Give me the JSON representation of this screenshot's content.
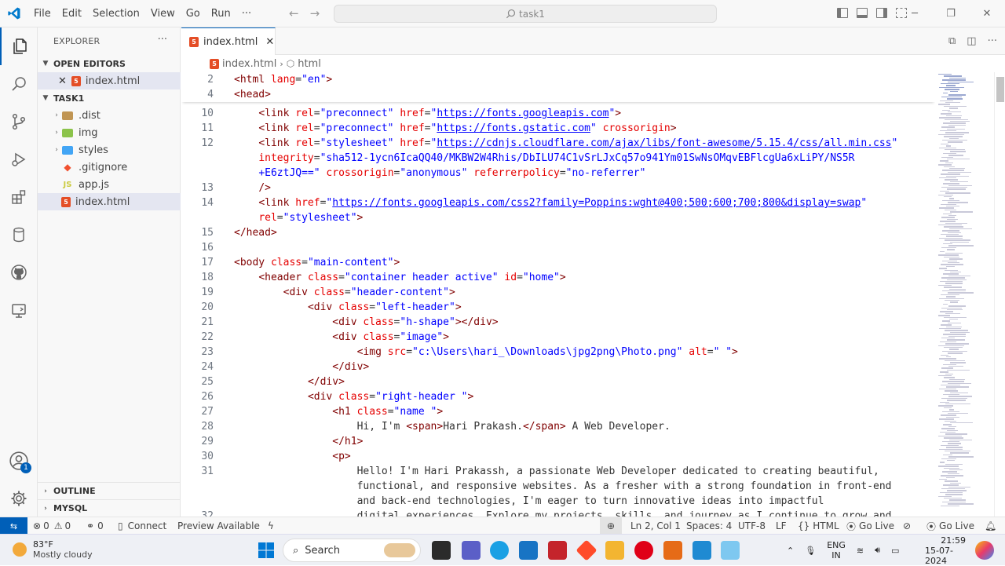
{
  "titlebar": {
    "menu": [
      "File",
      "Edit",
      "Selection",
      "View",
      "Go",
      "Run",
      "···"
    ],
    "search_text": "task1"
  },
  "sidebar": {
    "title": "EXPLORER",
    "more": "···",
    "open_editors_label": "OPEN EDITORS",
    "open_editor_file": "index.html",
    "folder_label": "TASK1",
    "items": [
      {
        "label": ".dist",
        "type": "folder",
        "icon": "folder-dist-icon"
      },
      {
        "label": "img",
        "type": "folder",
        "icon": "folder-img-icon"
      },
      {
        "label": "styles",
        "type": "folder",
        "icon": "folder-styles-icon"
      },
      {
        "label": ".gitignore",
        "type": "file",
        "icon": "git-icon"
      },
      {
        "label": "app.js",
        "type": "file",
        "icon": "js-icon"
      },
      {
        "label": "index.html",
        "type": "file",
        "icon": "html5-icon"
      }
    ],
    "outline_label": "OUTLINE",
    "mysql_label": "MYSQL"
  },
  "activity": {
    "accounts_badge": "1"
  },
  "editor": {
    "tab_label": "index.html",
    "breadcrumb_file": "index.html",
    "breadcrumb_symbol": "html",
    "sticky_lines": [
      {
        "n": "2",
        "code": [
          [
            "tg",
            "<html "
          ],
          [
            "at",
            "lang"
          ],
          [
            "tx",
            "="
          ],
          [
            "st",
            "\"en\""
          ],
          [
            "tg",
            ">"
          ]
        ]
      },
      {
        "n": "4",
        "code": [
          [
            "tg",
            "<head>"
          ]
        ]
      }
    ],
    "lines": [
      {
        "n": "10",
        "indent": 4,
        "code": [
          [
            "tg",
            "<link "
          ],
          [
            "at",
            "rel"
          ],
          [
            "tx",
            "="
          ],
          [
            "st",
            "\"preconnect\""
          ],
          [
            "tx",
            " "
          ],
          [
            "at",
            "href"
          ],
          [
            "tx",
            "="
          ],
          [
            "st",
            "\""
          ],
          [
            "lk",
            "https://fonts.googleapis.com"
          ],
          [
            "st",
            "\""
          ],
          [
            "tg",
            ">"
          ]
        ]
      },
      {
        "n": "11",
        "indent": 4,
        "code": [
          [
            "tg",
            "<link "
          ],
          [
            "at",
            "rel"
          ],
          [
            "tx",
            "="
          ],
          [
            "st",
            "\"preconnect\""
          ],
          [
            "tx",
            " "
          ],
          [
            "at",
            "href"
          ],
          [
            "tx",
            "="
          ],
          [
            "st",
            "\""
          ],
          [
            "lk",
            "https://fonts.gstatic.com"
          ],
          [
            "st",
            "\""
          ],
          [
            "tx",
            " "
          ],
          [
            "at",
            "crossorigin"
          ],
          [
            "tg",
            ">"
          ]
        ]
      },
      {
        "n": "12",
        "indent": 4,
        "code": [
          [
            "tg",
            "<link "
          ],
          [
            "at",
            "rel"
          ],
          [
            "tx",
            "="
          ],
          [
            "st",
            "\"stylesheet\""
          ],
          [
            "tx",
            " "
          ],
          [
            "at",
            "href"
          ],
          [
            "tx",
            "="
          ],
          [
            "st",
            "\""
          ],
          [
            "lk",
            "https://cdnjs.cloudflare.com/ajax/libs/font-awesome/5.15.4/css/all.min.css"
          ],
          [
            "st",
            "\""
          ]
        ]
      },
      {
        "n": "",
        "indent": 4,
        "code": [
          [
            "at",
            "integrity"
          ],
          [
            "tx",
            "="
          ],
          [
            "st",
            "\"sha512-1ycn6IcaQQ40/MKBW2W4Rhis/DbILU74C1vSrLJxCq57o941Ym01SwNsOMqvEBFlcgUa6xLiPY/NS5R"
          ]
        ]
      },
      {
        "n": "",
        "indent": 4,
        "code": [
          [
            "st",
            "+E6ztJQ==\""
          ],
          [
            "tx",
            " "
          ],
          [
            "at",
            "crossorigin"
          ],
          [
            "tx",
            "="
          ],
          [
            "st",
            "\"anonymous\""
          ],
          [
            "tx",
            " "
          ],
          [
            "at",
            "referrerpolicy"
          ],
          [
            "tx",
            "="
          ],
          [
            "st",
            "\"no-referrer\""
          ]
        ]
      },
      {
        "n": "13",
        "indent": 4,
        "code": [
          [
            "tg",
            "/>"
          ]
        ]
      },
      {
        "n": "14",
        "indent": 4,
        "code": [
          [
            "tg",
            "<link "
          ],
          [
            "at",
            "href"
          ],
          [
            "tx",
            "="
          ],
          [
            "st",
            "\""
          ],
          [
            "lk",
            "https://fonts.googleapis.com/css2?family=Poppins:wght@400;500;600;700;800&display=swap"
          ],
          [
            "st",
            "\""
          ]
        ]
      },
      {
        "n": "",
        "indent": 4,
        "code": [
          [
            "at",
            "rel"
          ],
          [
            "tx",
            "="
          ],
          [
            "st",
            "\"stylesheet\""
          ],
          [
            "tg",
            ">"
          ]
        ]
      },
      {
        "n": "15",
        "indent": 0,
        "code": [
          [
            "tg",
            "</head>"
          ]
        ]
      },
      {
        "n": "16",
        "indent": 0,
        "code": []
      },
      {
        "n": "17",
        "indent": 0,
        "code": [
          [
            "tg",
            "<body "
          ],
          [
            "at",
            "class"
          ],
          [
            "tx",
            "="
          ],
          [
            "st",
            "\"main-content\""
          ],
          [
            "tg",
            ">"
          ]
        ]
      },
      {
        "n": "18",
        "indent": 4,
        "code": [
          [
            "tg",
            "<header "
          ],
          [
            "at",
            "class"
          ],
          [
            "tx",
            "="
          ],
          [
            "st",
            "\"container header active\""
          ],
          [
            "tx",
            " "
          ],
          [
            "at",
            "id"
          ],
          [
            "tx",
            "="
          ],
          [
            "st",
            "\"home\""
          ],
          [
            "tg",
            ">"
          ]
        ]
      },
      {
        "n": "19",
        "indent": 8,
        "code": [
          [
            "tg",
            "<div "
          ],
          [
            "at",
            "class"
          ],
          [
            "tx",
            "="
          ],
          [
            "st",
            "\"header-content\""
          ],
          [
            "tg",
            ">"
          ]
        ]
      },
      {
        "n": "20",
        "indent": 12,
        "code": [
          [
            "tg",
            "<div "
          ],
          [
            "at",
            "class"
          ],
          [
            "tx",
            "="
          ],
          [
            "st",
            "\"left-header\""
          ],
          [
            "tg",
            ">"
          ]
        ]
      },
      {
        "n": "21",
        "indent": 16,
        "code": [
          [
            "tg",
            "<div "
          ],
          [
            "at",
            "class"
          ],
          [
            "tx",
            "="
          ],
          [
            "st",
            "\"h-shape\""
          ],
          [
            "tg",
            "></div>"
          ]
        ]
      },
      {
        "n": "22",
        "indent": 16,
        "code": [
          [
            "tg",
            "<div "
          ],
          [
            "at",
            "class"
          ],
          [
            "tx",
            "="
          ],
          [
            "st",
            "\"image\""
          ],
          [
            "tg",
            ">"
          ]
        ]
      },
      {
        "n": "23",
        "indent": 20,
        "code": [
          [
            "tg",
            "<img "
          ],
          [
            "at",
            "src"
          ],
          [
            "tx",
            "="
          ],
          [
            "st",
            "\"c:\\Users\\hari_\\Downloads\\jpg2png\\Photo.png\""
          ],
          [
            "tx",
            " "
          ],
          [
            "at",
            "alt"
          ],
          [
            "tx",
            "="
          ],
          [
            "st",
            "\" \""
          ],
          [
            "tg",
            ">"
          ]
        ]
      },
      {
        "n": "24",
        "indent": 16,
        "code": [
          [
            "tg",
            "</div>"
          ]
        ]
      },
      {
        "n": "25",
        "indent": 12,
        "code": [
          [
            "tg",
            "</div>"
          ]
        ]
      },
      {
        "n": "26",
        "indent": 12,
        "code": [
          [
            "tg",
            "<div "
          ],
          [
            "at",
            "class"
          ],
          [
            "tx",
            "="
          ],
          [
            "st",
            "\"right-header \""
          ],
          [
            "tg",
            ">"
          ]
        ]
      },
      {
        "n": "27",
        "indent": 16,
        "code": [
          [
            "tg",
            "<h1 "
          ],
          [
            "at",
            "class"
          ],
          [
            "tx",
            "="
          ],
          [
            "st",
            "\"name \""
          ],
          [
            "tg",
            ">"
          ]
        ]
      },
      {
        "n": "28",
        "indent": 20,
        "code": [
          [
            "tx",
            "Hi, I'm "
          ],
          [
            "tg",
            "<span>"
          ],
          [
            "tx",
            "Hari Prakash."
          ],
          [
            "tg",
            "</span>"
          ],
          [
            "tx",
            " A Web Developer."
          ]
        ]
      },
      {
        "n": "29",
        "indent": 16,
        "code": [
          [
            "tg",
            "</h1>"
          ]
        ]
      },
      {
        "n": "30",
        "indent": 16,
        "code": [
          [
            "tg",
            "<p>"
          ]
        ]
      },
      {
        "n": "31",
        "indent": 20,
        "code": [
          [
            "tx",
            "Hello! I'm Hari Prakassh, a passionate Web Developer dedicated to creating beautiful,"
          ]
        ]
      },
      {
        "n": "",
        "indent": 20,
        "code": [
          [
            "tx",
            "functional, and responsive websites. As a fresher with a strong foundation in front-end"
          ]
        ]
      },
      {
        "n": "",
        "indent": 20,
        "code": [
          [
            "tx",
            "and back-end technologies, I'm eager to turn innovative ideas into impactful"
          ]
        ]
      },
      {
        "n": "32",
        "indent": 20,
        "code": [
          [
            "tx",
            "digital experiences. Explore my projects, skills, and journey as I continue to grow and"
          ]
        ]
      }
    ]
  },
  "statusbar": {
    "errors": "0",
    "warnings": "0",
    "ports": "0",
    "connect": "Connect",
    "preview": "Preview Available",
    "position": "Ln 2, Col 1",
    "spaces": "Spaces: 4",
    "encoding": "UTF-8",
    "eol": "LF",
    "language": "HTML",
    "golive1": "Go Live",
    "golive2": "Go Live"
  },
  "taskbar": {
    "temp": "83°F",
    "weather": "Mostly cloudy",
    "search": "Search",
    "lang1": "ENG",
    "lang2": "IN",
    "time": "21:59",
    "date": "15-07-2024"
  }
}
